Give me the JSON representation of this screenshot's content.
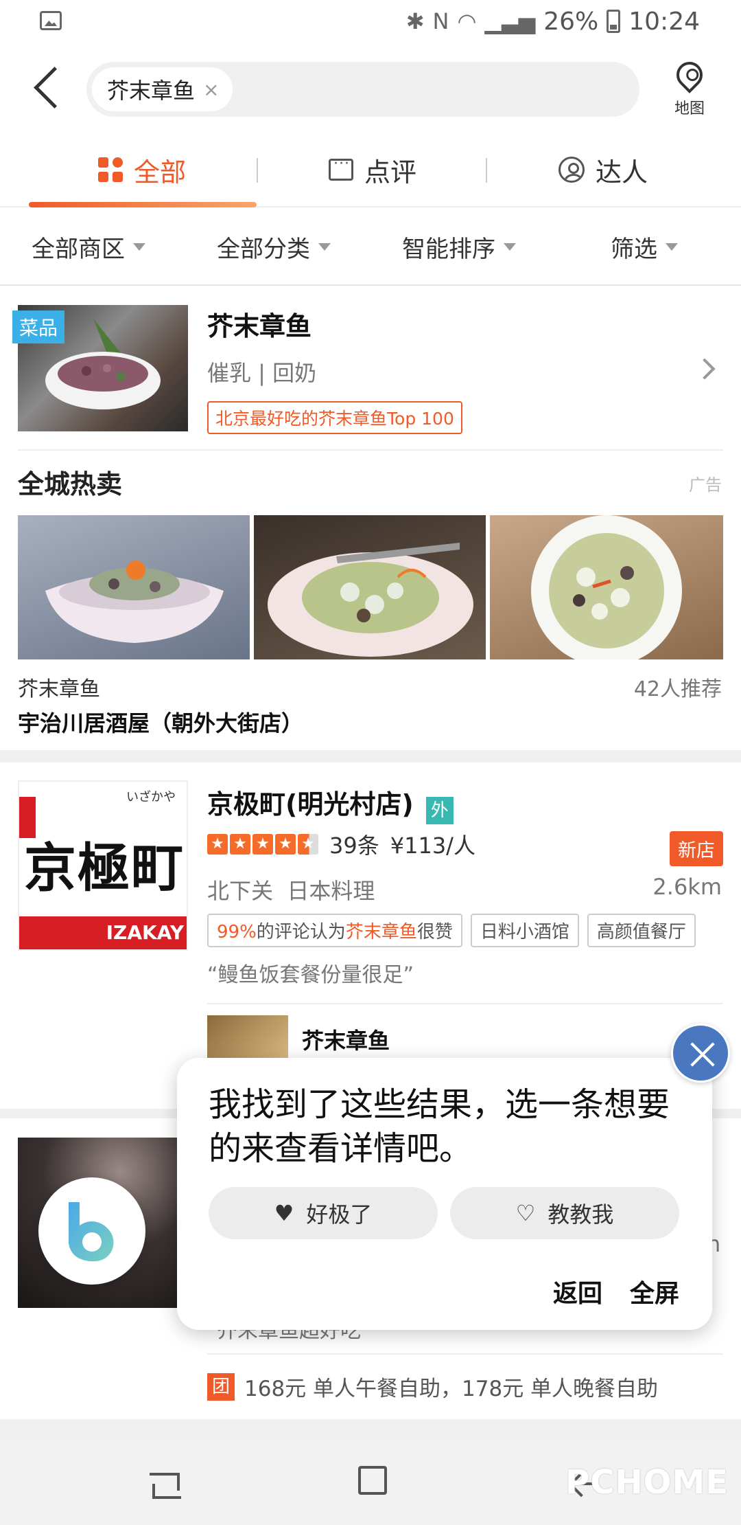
{
  "status": {
    "battery": "26%",
    "time": "10:24"
  },
  "search": {
    "query": "芥末章鱼",
    "clear": "×",
    "map_label": "地图"
  },
  "tabs": [
    {
      "label": "全部",
      "icon": "grid-icon"
    },
    {
      "label": "点评",
      "icon": "comment-icon"
    },
    {
      "label": "达人",
      "icon": "user-icon"
    }
  ],
  "filters": [
    "全部商区",
    "全部分类",
    "智能排序",
    "筛选"
  ],
  "dish": {
    "tag": "菜品",
    "title": "芥末章鱼",
    "subtitle": "催乳 | 回奶",
    "rank": "北京最好吃的芥末章鱼Top 100"
  },
  "hot": {
    "title": "全城热卖",
    "ad": "广告",
    "dish_name": "芥末章鱼",
    "recommend": "42人推荐",
    "shop": "宇治川居酒屋（朝外大街店）"
  },
  "shop": {
    "logo_top": "いざかや",
    "logo_text": "京極町",
    "logo_strip": "IZAKAY",
    "name": "京极町(明光村店)",
    "takeout": "外",
    "rating": 4.5,
    "reviews": "39条",
    "price": "¥113/人",
    "new_badge": "新店",
    "area": "北下关",
    "category": "日本料理",
    "distance": "2.6km",
    "praise_pct": "99%",
    "praise_mid": "的评论认为",
    "praise_dish": "芥末章鱼",
    "praise_end": "很赞",
    "tag1": "日料小酒馆",
    "tag2": "高颜值餐厅",
    "quote": "“鳗鱼饭套餐份量很足”",
    "rec_dish": "芥末章鱼"
  },
  "shop2": {
    "review_snippet": "芥末章鱼超好吃",
    "deal_badge": "团",
    "deal": "168元 单人午餐自助，178元 单人晚餐自助",
    "distance_tail": "n"
  },
  "assistant": {
    "message": "我找到了这些结果，选一条想要的来查看详情吧。",
    "like": "好极了",
    "teach": "教教我",
    "back": "返回",
    "fullscreen": "全屏"
  },
  "watermark": "PCHOME",
  "colors": {
    "accent": "#f05a28",
    "dish_tag": "#3bb0e6",
    "takeout": "#38b8b0",
    "fab": "#4a78c0"
  }
}
